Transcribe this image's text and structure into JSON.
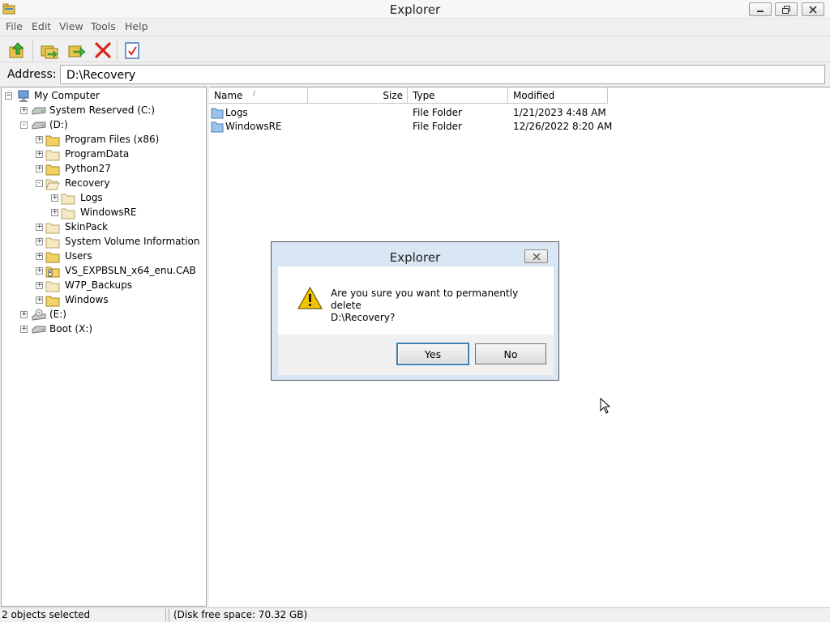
{
  "window": {
    "title": "Explorer"
  },
  "menu": [
    "File",
    "Edit",
    "View",
    "Tools",
    "Help"
  ],
  "toolbar": {
    "buttons": [
      {
        "icon": "folder-up-icon"
      },
      {
        "icon": "copy-icon"
      },
      {
        "icon": "move-icon"
      },
      {
        "icon": "delete-icon"
      },
      {
        "icon": "properties-icon"
      }
    ]
  },
  "address": {
    "label": "Address:",
    "value": "D:\\Recovery"
  },
  "tree": {
    "root": "My Computer",
    "items": [
      {
        "label": "System Reserved (C:)",
        "icon": "drive-icon",
        "expander": "+"
      },
      {
        "label": "(D:)",
        "icon": "drive-icon",
        "expander": "-"
      },
      {
        "label": "Program Files (x86)",
        "icon": "folder-icon",
        "expander": "+"
      },
      {
        "label": "ProgramData",
        "icon": "folder-icon",
        "expander": "+"
      },
      {
        "label": "Python27",
        "icon": "folder-icon",
        "expander": "+"
      },
      {
        "label": "Recovery",
        "icon": "folder-open-icon",
        "expander": "-"
      },
      {
        "label": "Logs",
        "icon": "folder-icon",
        "expander": "+"
      },
      {
        "label": "WindowsRE",
        "icon": "folder-icon",
        "expander": "+"
      },
      {
        "label": "SkinPack",
        "icon": "folder-icon",
        "expander": "+"
      },
      {
        "label": "System Volume Information",
        "icon": "folder-icon",
        "expander": "+"
      },
      {
        "label": "Users",
        "icon": "folder-icon",
        "expander": "+"
      },
      {
        "label": "VS_EXPBSLN_x64_enu.CAB",
        "icon": "cab-icon",
        "expander": "+"
      },
      {
        "label": "W7P_Backups",
        "icon": "folder-icon",
        "expander": "+"
      },
      {
        "label": "Windows",
        "icon": "folder-icon",
        "expander": "+"
      },
      {
        "label": "(E:)",
        "icon": "cdrom-icon",
        "expander": "+"
      },
      {
        "label": "Boot (X:)",
        "icon": "drive-icon",
        "expander": "+"
      }
    ]
  },
  "list": {
    "columns": {
      "name": "Name",
      "size": "Size",
      "type": "Type",
      "modified": "Modified"
    },
    "rows": [
      {
        "name": "Logs",
        "size": "",
        "type": "File Folder",
        "modified": "1/21/2023 4:48 AM"
      },
      {
        "name": "WindowsRE",
        "size": "",
        "type": "File Folder",
        "modified": "12/26/2022 8:20 AM"
      }
    ]
  },
  "status": {
    "selection": "2 objects selected",
    "disk": "(Disk free space: 70.32 GB)"
  },
  "dialog": {
    "title": "Explorer",
    "line1": "Are you sure you want to permanently delete",
    "line2": "D:\\Recovery?",
    "yes": "Yes",
    "no": "No"
  },
  "colors": {
    "dialog_frame": "#d9e6f4",
    "default_button_border": "#3c7fb1",
    "delete_red": "#d9261c"
  }
}
